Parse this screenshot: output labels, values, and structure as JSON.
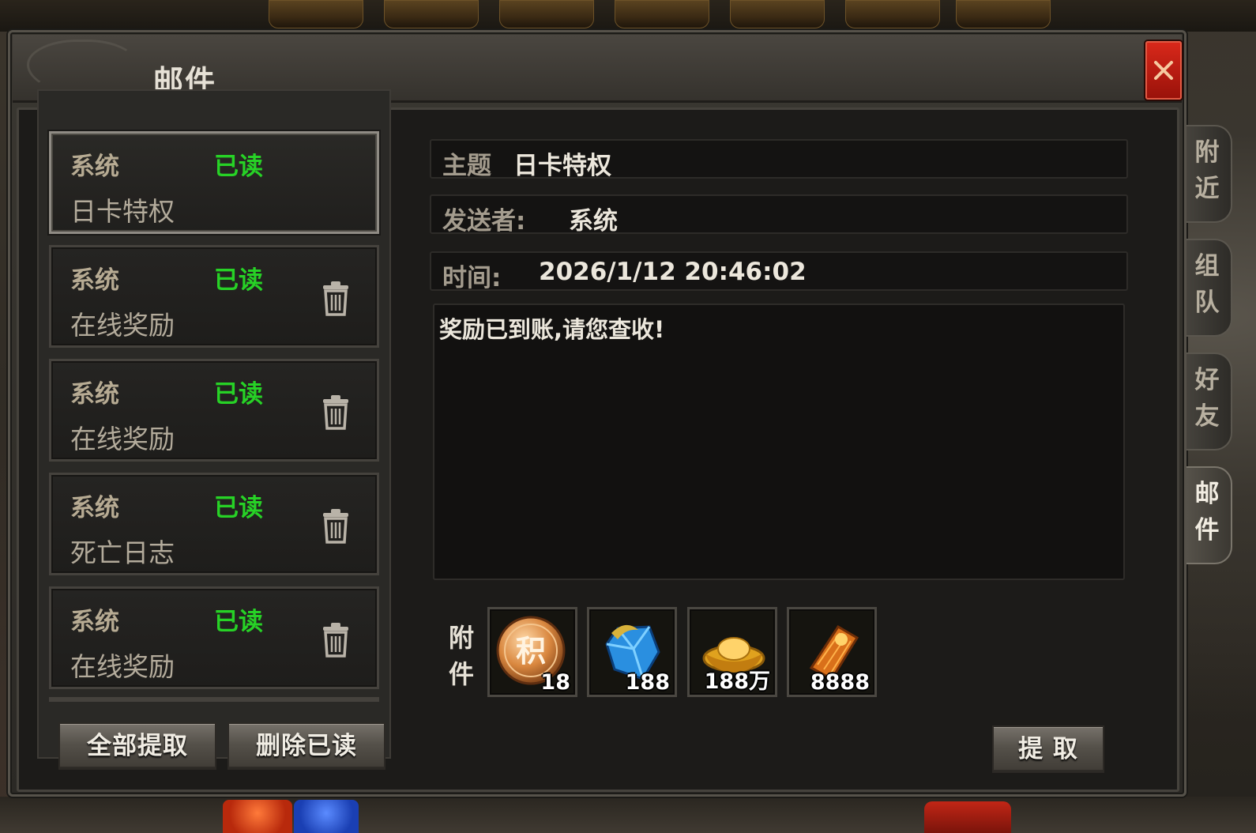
{
  "window": {
    "title": "邮件"
  },
  "mail_list": [
    {
      "sender": "系统",
      "status": "已读",
      "subject": "日卡特权",
      "selected": true
    },
    {
      "sender": "系统",
      "status": "已读",
      "subject": "在线奖励"
    },
    {
      "sender": "系统",
      "status": "已读",
      "subject": "在线奖励"
    },
    {
      "sender": "系统",
      "status": "已读",
      "subject": "死亡日志"
    },
    {
      "sender": "系统",
      "status": "已读",
      "subject": "在线奖励"
    }
  ],
  "list_buttons": {
    "claim_all": "全部提取",
    "delete_read": "删除已读"
  },
  "detail": {
    "subject_label": "主题",
    "subject": "日卡特权",
    "sender_label": "发送者:",
    "sender": "系统",
    "time_label": "时间:",
    "time": "2026/1/12 20:46:02",
    "body": "奖励已到账,请您查收!",
    "attachments_label": "附件",
    "attachments": [
      {
        "icon": "points-coin-icon",
        "glyph": "积",
        "count": "18"
      },
      {
        "icon": "blue-gem-icon",
        "count": "188"
      },
      {
        "icon": "gold-ingot-icon",
        "count": "188万"
      },
      {
        "icon": "scroll-ticket-icon",
        "count": "8888"
      }
    ],
    "claim_button": "提 取"
  },
  "side_tabs": [
    {
      "label": "附近",
      "active": false
    },
    {
      "label": "组队",
      "active": false
    },
    {
      "label": "好友",
      "active": false
    },
    {
      "label": "邮件",
      "active": true
    }
  ],
  "colors": {
    "read_status": "#27d226",
    "close_button": "#d8281a"
  }
}
